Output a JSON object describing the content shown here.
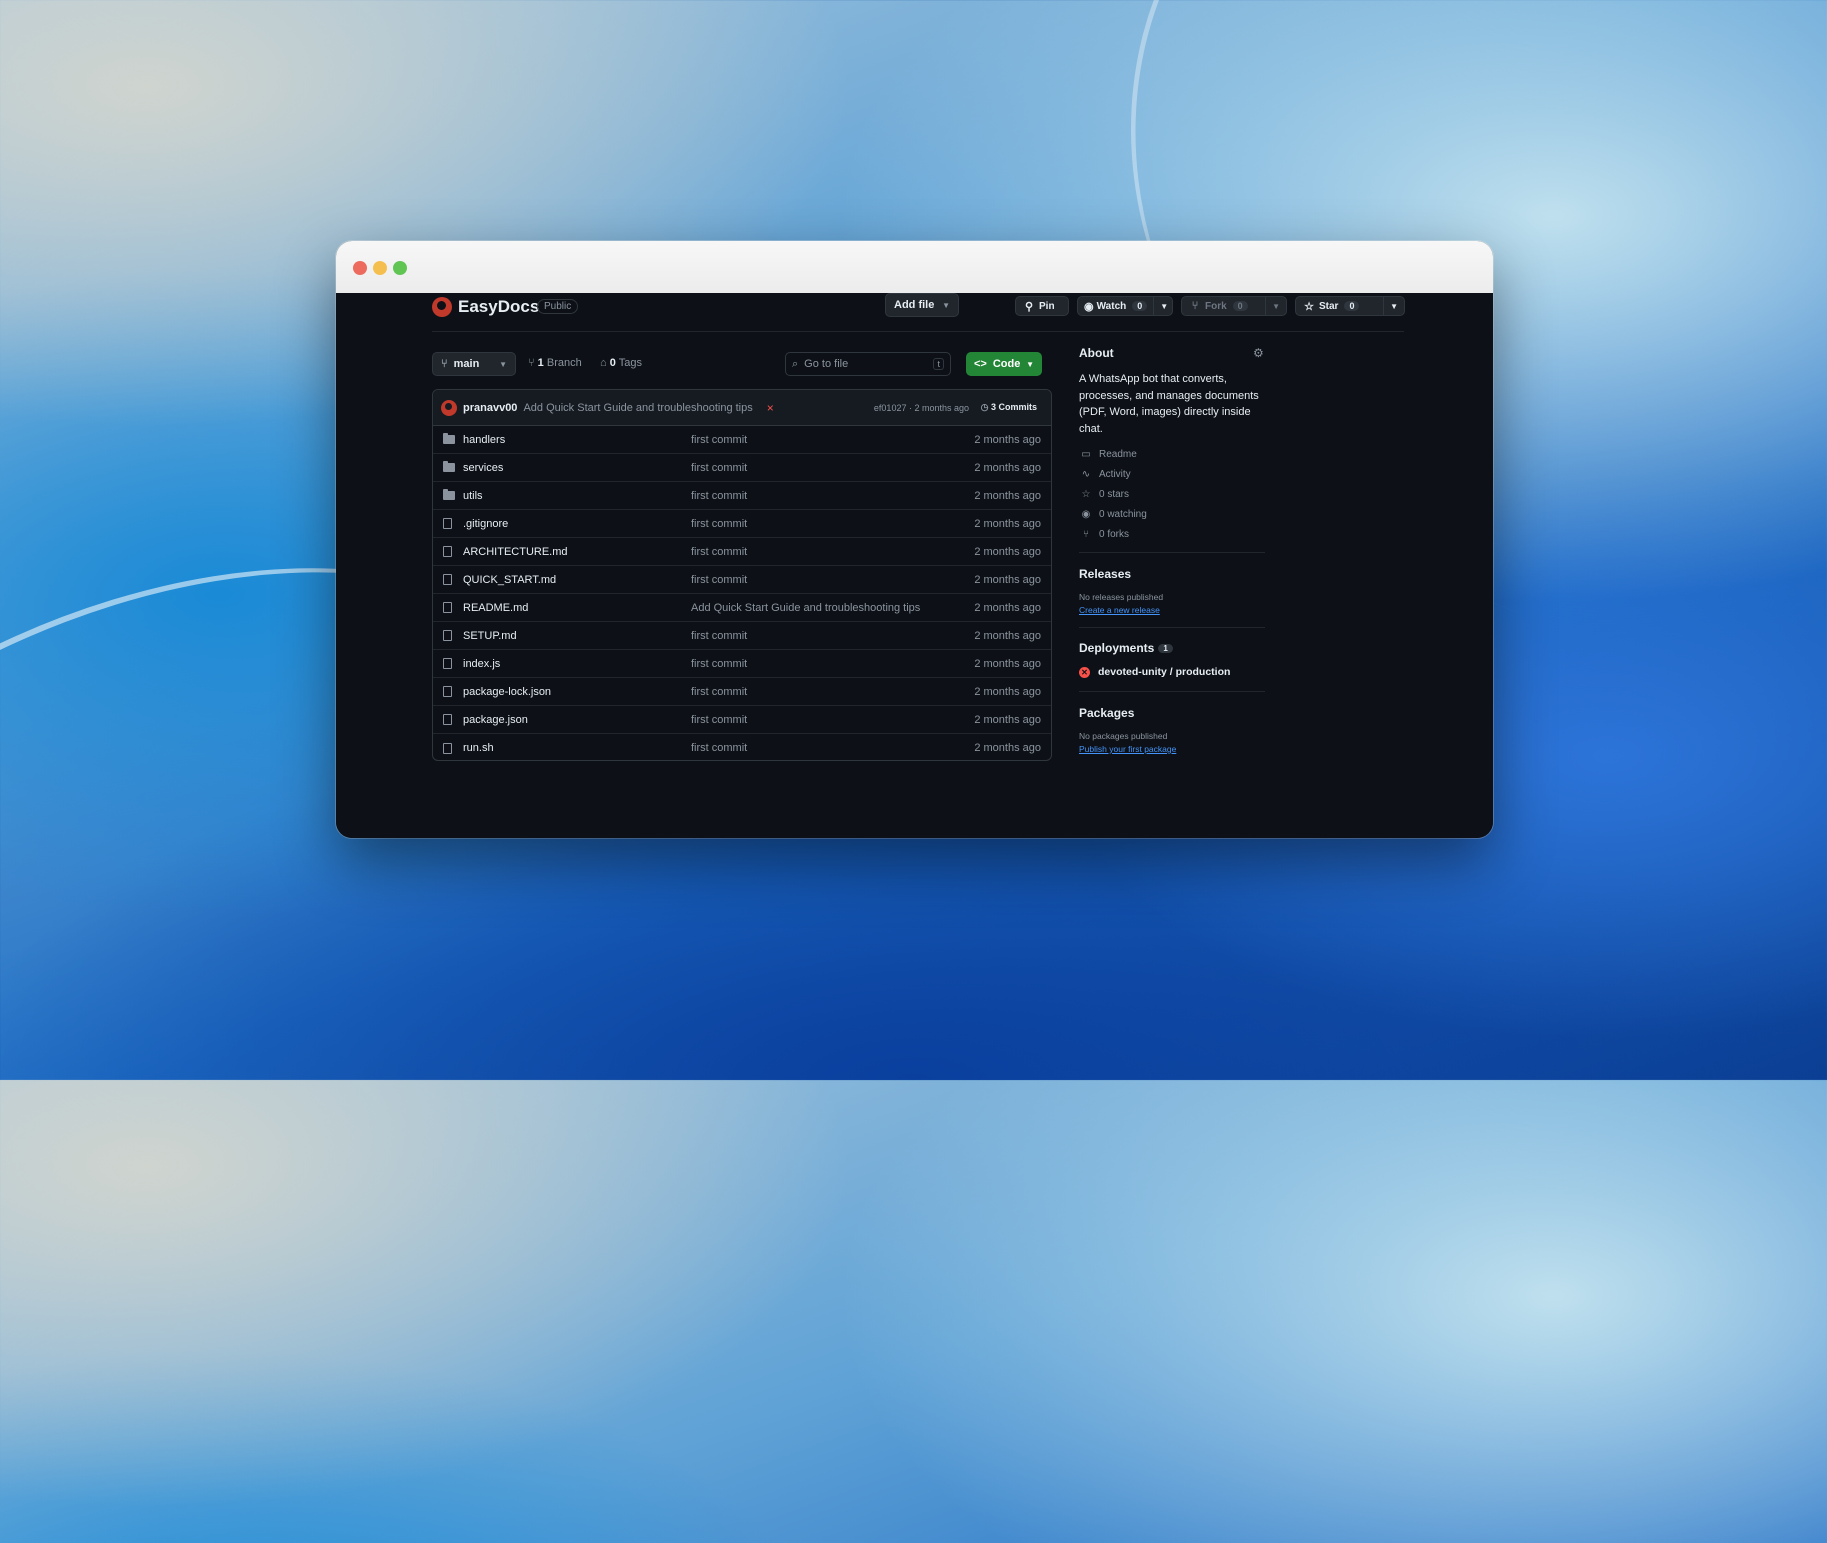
{
  "repo": {
    "name": "EasyDocs",
    "visibility": "Public"
  },
  "header_buttons": {
    "pin": "Pin",
    "watch": "Watch",
    "watch_count": "0",
    "fork": "Fork",
    "fork_count": "0",
    "star": "Star",
    "star_count": "0"
  },
  "toolbar": {
    "branch": "main",
    "branches_count": "1",
    "branches_label": "Branch",
    "tags_count": "0",
    "tags_label": "Tags",
    "search_placeholder": "Go to file",
    "search_shortcut": "t",
    "add_file": "Add file",
    "code": "Code"
  },
  "latest_commit": {
    "author": "pranavv00",
    "message": "Add Quick Start Guide and troubleshooting tips",
    "status": "×",
    "hash_time": "ef01027 · 2 months ago",
    "commits": "3 Commits"
  },
  "files": [
    {
      "name": "handlers",
      "type": "folder",
      "message": "first commit",
      "date": "2 months ago"
    },
    {
      "name": "services",
      "type": "folder",
      "message": "first commit",
      "date": "2 months ago"
    },
    {
      "name": "utils",
      "type": "folder",
      "message": "first commit",
      "date": "2 months ago"
    },
    {
      "name": ".gitignore",
      "type": "file",
      "message": "first commit",
      "date": "2 months ago"
    },
    {
      "name": "ARCHITECTURE.md",
      "type": "file",
      "message": "first commit",
      "date": "2 months ago"
    },
    {
      "name": "QUICK_START.md",
      "type": "file",
      "message": "first commit",
      "date": "2 months ago"
    },
    {
      "name": "README.md",
      "type": "file",
      "message": "Add Quick Start Guide and troubleshooting tips",
      "date": "2 months ago"
    },
    {
      "name": "SETUP.md",
      "type": "file",
      "message": "first commit",
      "date": "2 months ago"
    },
    {
      "name": "index.js",
      "type": "file",
      "message": "first commit",
      "date": "2 months ago"
    },
    {
      "name": "package-lock.json",
      "type": "file",
      "message": "first commit",
      "date": "2 months ago"
    },
    {
      "name": "package.json",
      "type": "file",
      "message": "first commit",
      "date": "2 months ago"
    },
    {
      "name": "run.sh",
      "type": "file",
      "message": "first commit",
      "date": "2 months ago"
    }
  ],
  "about": {
    "title": "About",
    "description": "A WhatsApp bot that converts, processes, and manages documents (PDF, Word, images) directly inside chat.",
    "readme": "Readme",
    "activity": "Activity",
    "stars": "0 stars",
    "watching": "0 watching",
    "forks": "0 forks"
  },
  "releases": {
    "title": "Releases",
    "empty": "No releases published",
    "link": "Create a new release"
  },
  "deployments": {
    "title": "Deployments",
    "count": "1",
    "item": "devoted-unity / production"
  },
  "packages": {
    "title": "Packages",
    "empty": "No packages published",
    "link": "Publish your first package"
  },
  "colors": {
    "bg": "#0d1117",
    "accent_green": "#238636",
    "link": "#4493f8",
    "error": "#f85149"
  }
}
